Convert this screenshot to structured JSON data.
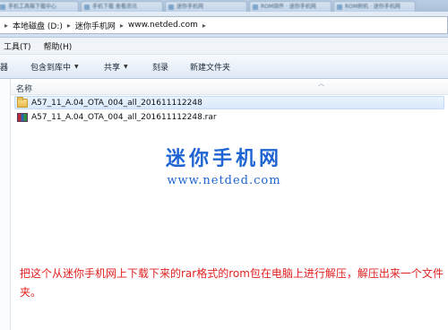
{
  "tabs": [
    {
      "label": "手机工具箱下载中心"
    },
    {
      "label": "手机下载 查看资讯"
    },
    {
      "label": "迷你手机网"
    },
    {
      "label": "ROM固件 · 迷你手机网"
    },
    {
      "label": "ROM刷机 · 迷你手机网"
    }
  ],
  "address": {
    "crumbs": [
      "本地磁盘 (D:)",
      "迷你手机网",
      "www.netded.com"
    ],
    "separator": "▸"
  },
  "menu": {
    "items": [
      "工具(T)",
      "帮助(H)"
    ]
  },
  "toolbar": {
    "partial_label": "器",
    "include_label": "包含到库中",
    "share_label": "共享",
    "burn_label": "刻录",
    "new_folder_label": "新建文件夹"
  },
  "list": {
    "header_name": "名称",
    "rows": [
      {
        "name": "A57_11_A.04_OTA_004_all_201611112248",
        "icon": "folder-icon",
        "selected": true
      },
      {
        "name": "A57_11_A.04_OTA_004_all_201611112248.rar",
        "icon": "rar-archive-icon",
        "selected": false
      }
    ]
  },
  "watermark": {
    "brand": "迷你手机网",
    "url": "www.netded.com"
  },
  "note": "把这个从迷你手机网上下载下来的rar格式的rom包在电脑上进行解压，解压出来一个文件夹。",
  "colors": {
    "brand_blue": "#1e64d2",
    "note_red": "#e02121"
  }
}
